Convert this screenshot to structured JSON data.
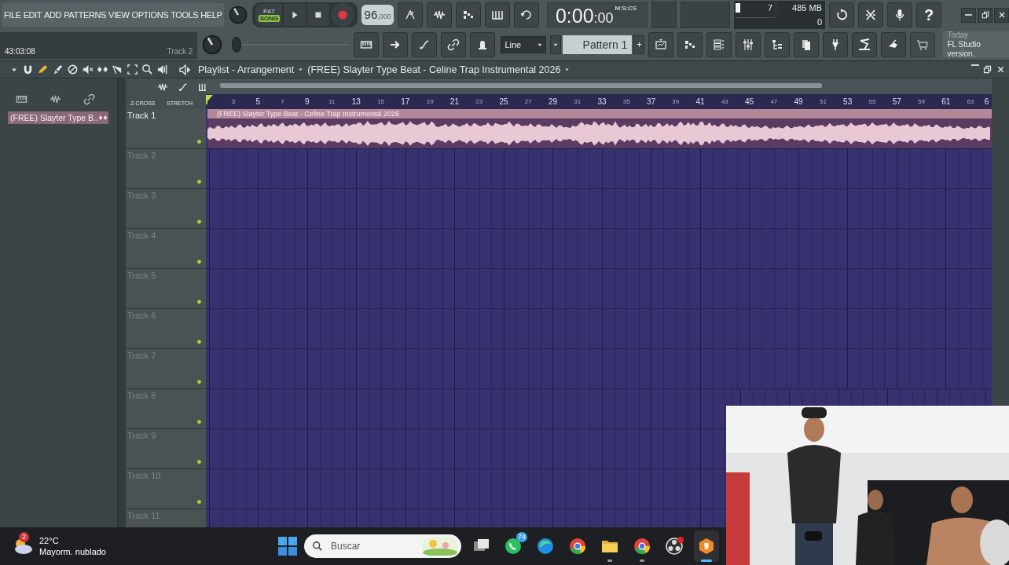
{
  "menu": [
    "FILE",
    "EDIT",
    "ADD",
    "PATTERNS",
    "VIEW",
    "OPTIONS",
    "TOOLS",
    "HELP"
  ],
  "hint_bar": {
    "position": "43:03:08",
    "target": "Track 2"
  },
  "transport": {
    "pat_label": "PAT",
    "song_label": "SONG",
    "mode_song": true,
    "recording": false,
    "tempo": "96",
    "tempo_decimals": ",000"
  },
  "pitch": {
    "level": 0
  },
  "time": {
    "main": "0:00",
    "centis": ":00",
    "unit": "M:S:CS"
  },
  "monitor": {
    "voices": "7",
    "memory": "485 MB",
    "cpu": "0",
    "level": 0.05
  },
  "help": "?",
  "snap": {
    "value": "Line"
  },
  "pattern": {
    "name": "Pattern 1",
    "add": "+"
  },
  "news": {
    "label": "Today",
    "text": "FL Studio version."
  },
  "playlist": {
    "title": "Playlist - Arrangement",
    "arrangement": "(FREE) Slayter Type Beat - Celine  Trap Instrumental 2026",
    "zcross": "Z-CROSS",
    "stretch": "STRETCH",
    "picker": [
      {
        "name": "(FREE) Slayter Type B..",
        "selected": true
      }
    ],
    "ruler": [
      "3",
      "5",
      "7",
      "9",
      "11",
      "13",
      "15",
      "17",
      "19",
      "21",
      "23",
      "25",
      "27",
      "29",
      "31",
      "33",
      "35",
      "37",
      "39",
      "41",
      "43",
      "45",
      "47",
      "49",
      "51",
      "53",
      "55",
      "57",
      "59",
      "61",
      "63",
      "6"
    ],
    "tracks": [
      {
        "name": "Track 1",
        "active": true,
        "clip": {
          "title": "(FREE) Slayter Type Beat - Celine  Trap Instrumental 2026"
        }
      },
      {
        "name": "Track 2",
        "active": false
      },
      {
        "name": "Track 3",
        "active": false
      },
      {
        "name": "Track 4",
        "active": false
      },
      {
        "name": "Track 5",
        "active": false
      },
      {
        "name": "Track 6",
        "active": false
      },
      {
        "name": "Track 7",
        "active": false
      },
      {
        "name": "Track 8",
        "active": false
      },
      {
        "name": "Track 9",
        "active": false
      },
      {
        "name": "Track 10",
        "active": false
      },
      {
        "name": "Track 11",
        "active": false
      }
    ]
  },
  "taskbar": {
    "weather": {
      "badge": "2",
      "temp": "22°C",
      "text": "Mayorm. nublado"
    },
    "search_placeholder": "Buscar",
    "apps": [
      {
        "kind": "taskview",
        "running": false,
        "selected": false
      },
      {
        "kind": "chat",
        "badge": "74",
        "running": false,
        "selected": false
      },
      {
        "kind": "edge",
        "running": false,
        "selected": false
      },
      {
        "kind": "chrome",
        "running": false,
        "selected": false
      },
      {
        "kind": "folder",
        "running": true,
        "selected": false
      },
      {
        "kind": "chrome",
        "running": true,
        "selected": false
      },
      {
        "kind": "obs",
        "running": false,
        "selected": false
      },
      {
        "kind": "fl",
        "running": true,
        "selected": true
      }
    ]
  }
}
